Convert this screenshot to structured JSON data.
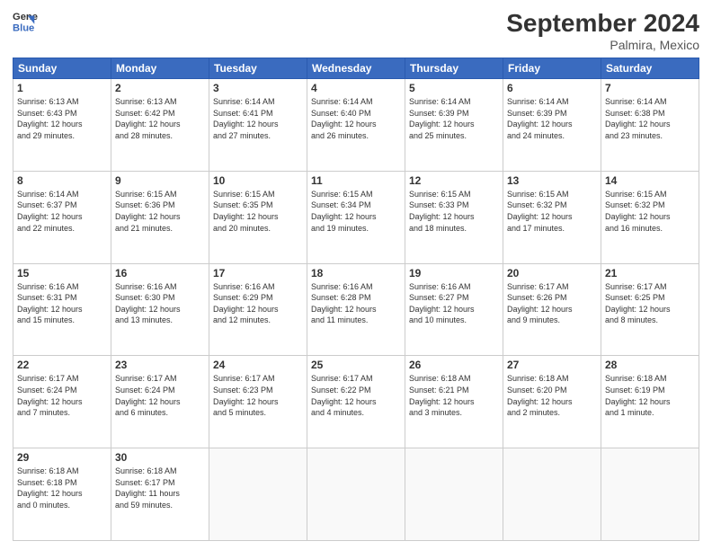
{
  "logo": {
    "line1": "General",
    "line2": "Blue"
  },
  "title": "September 2024",
  "location": "Palmira, Mexico",
  "days_of_week": [
    "Sunday",
    "Monday",
    "Tuesday",
    "Wednesday",
    "Thursday",
    "Friday",
    "Saturday"
  ],
  "weeks": [
    [
      {
        "day": "1",
        "text": "Sunrise: 6:13 AM\nSunset: 6:43 PM\nDaylight: 12 hours\nand 29 minutes."
      },
      {
        "day": "2",
        "text": "Sunrise: 6:13 AM\nSunset: 6:42 PM\nDaylight: 12 hours\nand 28 minutes."
      },
      {
        "day": "3",
        "text": "Sunrise: 6:14 AM\nSunset: 6:41 PM\nDaylight: 12 hours\nand 27 minutes."
      },
      {
        "day": "4",
        "text": "Sunrise: 6:14 AM\nSunset: 6:40 PM\nDaylight: 12 hours\nand 26 minutes."
      },
      {
        "day": "5",
        "text": "Sunrise: 6:14 AM\nSunset: 6:39 PM\nDaylight: 12 hours\nand 25 minutes."
      },
      {
        "day": "6",
        "text": "Sunrise: 6:14 AM\nSunset: 6:39 PM\nDaylight: 12 hours\nand 24 minutes."
      },
      {
        "day": "7",
        "text": "Sunrise: 6:14 AM\nSunset: 6:38 PM\nDaylight: 12 hours\nand 23 minutes."
      }
    ],
    [
      {
        "day": "8",
        "text": "Sunrise: 6:14 AM\nSunset: 6:37 PM\nDaylight: 12 hours\nand 22 minutes."
      },
      {
        "day": "9",
        "text": "Sunrise: 6:15 AM\nSunset: 6:36 PM\nDaylight: 12 hours\nand 21 minutes."
      },
      {
        "day": "10",
        "text": "Sunrise: 6:15 AM\nSunset: 6:35 PM\nDaylight: 12 hours\nand 20 minutes."
      },
      {
        "day": "11",
        "text": "Sunrise: 6:15 AM\nSunset: 6:34 PM\nDaylight: 12 hours\nand 19 minutes."
      },
      {
        "day": "12",
        "text": "Sunrise: 6:15 AM\nSunset: 6:33 PM\nDaylight: 12 hours\nand 18 minutes."
      },
      {
        "day": "13",
        "text": "Sunrise: 6:15 AM\nSunset: 6:32 PM\nDaylight: 12 hours\nand 17 minutes."
      },
      {
        "day": "14",
        "text": "Sunrise: 6:15 AM\nSunset: 6:32 PM\nDaylight: 12 hours\nand 16 minutes."
      }
    ],
    [
      {
        "day": "15",
        "text": "Sunrise: 6:16 AM\nSunset: 6:31 PM\nDaylight: 12 hours\nand 15 minutes."
      },
      {
        "day": "16",
        "text": "Sunrise: 6:16 AM\nSunset: 6:30 PM\nDaylight: 12 hours\nand 13 minutes."
      },
      {
        "day": "17",
        "text": "Sunrise: 6:16 AM\nSunset: 6:29 PM\nDaylight: 12 hours\nand 12 minutes."
      },
      {
        "day": "18",
        "text": "Sunrise: 6:16 AM\nSunset: 6:28 PM\nDaylight: 12 hours\nand 11 minutes."
      },
      {
        "day": "19",
        "text": "Sunrise: 6:16 AM\nSunset: 6:27 PM\nDaylight: 12 hours\nand 10 minutes."
      },
      {
        "day": "20",
        "text": "Sunrise: 6:17 AM\nSunset: 6:26 PM\nDaylight: 12 hours\nand 9 minutes."
      },
      {
        "day": "21",
        "text": "Sunrise: 6:17 AM\nSunset: 6:25 PM\nDaylight: 12 hours\nand 8 minutes."
      }
    ],
    [
      {
        "day": "22",
        "text": "Sunrise: 6:17 AM\nSunset: 6:24 PM\nDaylight: 12 hours\nand 7 minutes."
      },
      {
        "day": "23",
        "text": "Sunrise: 6:17 AM\nSunset: 6:24 PM\nDaylight: 12 hours\nand 6 minutes."
      },
      {
        "day": "24",
        "text": "Sunrise: 6:17 AM\nSunset: 6:23 PM\nDaylight: 12 hours\nand 5 minutes."
      },
      {
        "day": "25",
        "text": "Sunrise: 6:17 AM\nSunset: 6:22 PM\nDaylight: 12 hours\nand 4 minutes."
      },
      {
        "day": "26",
        "text": "Sunrise: 6:18 AM\nSunset: 6:21 PM\nDaylight: 12 hours\nand 3 minutes."
      },
      {
        "day": "27",
        "text": "Sunrise: 6:18 AM\nSunset: 6:20 PM\nDaylight: 12 hours\nand 2 minutes."
      },
      {
        "day": "28",
        "text": "Sunrise: 6:18 AM\nSunset: 6:19 PM\nDaylight: 12 hours\nand 1 minute."
      }
    ],
    [
      {
        "day": "29",
        "text": "Sunrise: 6:18 AM\nSunset: 6:18 PM\nDaylight: 12 hours\nand 0 minutes."
      },
      {
        "day": "30",
        "text": "Sunrise: 6:18 AM\nSunset: 6:17 PM\nDaylight: 11 hours\nand 59 minutes."
      },
      {
        "day": "",
        "text": ""
      },
      {
        "day": "",
        "text": ""
      },
      {
        "day": "",
        "text": ""
      },
      {
        "day": "",
        "text": ""
      },
      {
        "day": "",
        "text": ""
      }
    ]
  ]
}
